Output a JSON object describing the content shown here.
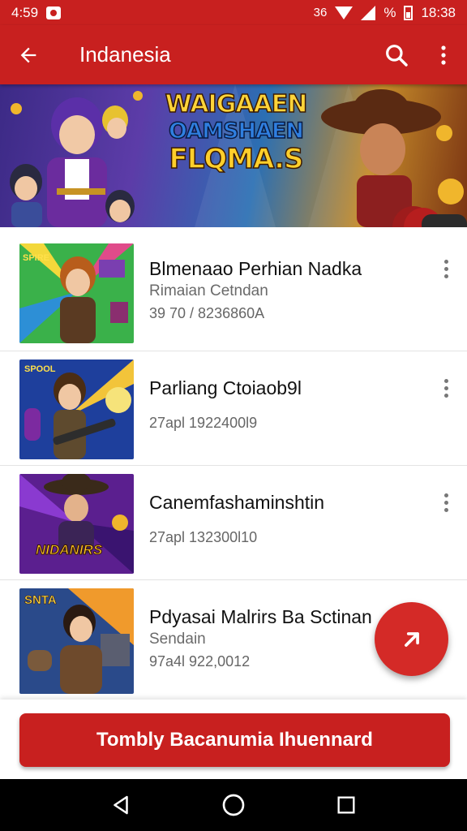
{
  "status_bar": {
    "time_left": "4:59",
    "percent": "%",
    "network_label": "36",
    "time_right": "18:38"
  },
  "app_bar": {
    "title": "Indanesia"
  },
  "banner": {
    "line1": "WAIGAAEN",
    "line2": "OAMSHAEN",
    "line3": "FLQMA.S"
  },
  "items": [
    {
      "title": "Blmenaao Perhian Nadka",
      "subtitle": "Rimaian Cetndan",
      "meta": "39 70 / 8236860A",
      "thumb_text": "SPIRE"
    },
    {
      "title": "Parliang Ctoiaob9l",
      "subtitle": "",
      "meta": "27apl 1922400l9",
      "thumb_text": "SPOOL"
    },
    {
      "title": "Canemfashaminshtin",
      "subtitle": "",
      "meta": "27apl 132300l10",
      "thumb_text": "NIDANIRS"
    },
    {
      "title": "Pdyasai Malrirs Ba Sctinan",
      "subtitle": "Sendain",
      "meta": "97a4l 922,0012",
      "thumb_text": "SNTA"
    }
  ],
  "cta": {
    "label": "Tombly Bacanumia Ihuennard"
  },
  "colors": {
    "primary": "#c8201f",
    "fab": "#d42a27"
  },
  "icons": {
    "back": "arrow-left-icon",
    "search": "search-icon",
    "more": "more-vert-icon",
    "fab": "arrow-up-right-icon",
    "nav_back": "triangle-back-icon",
    "nav_home": "circle-home-icon",
    "nav_recent": "square-recent-icon"
  }
}
